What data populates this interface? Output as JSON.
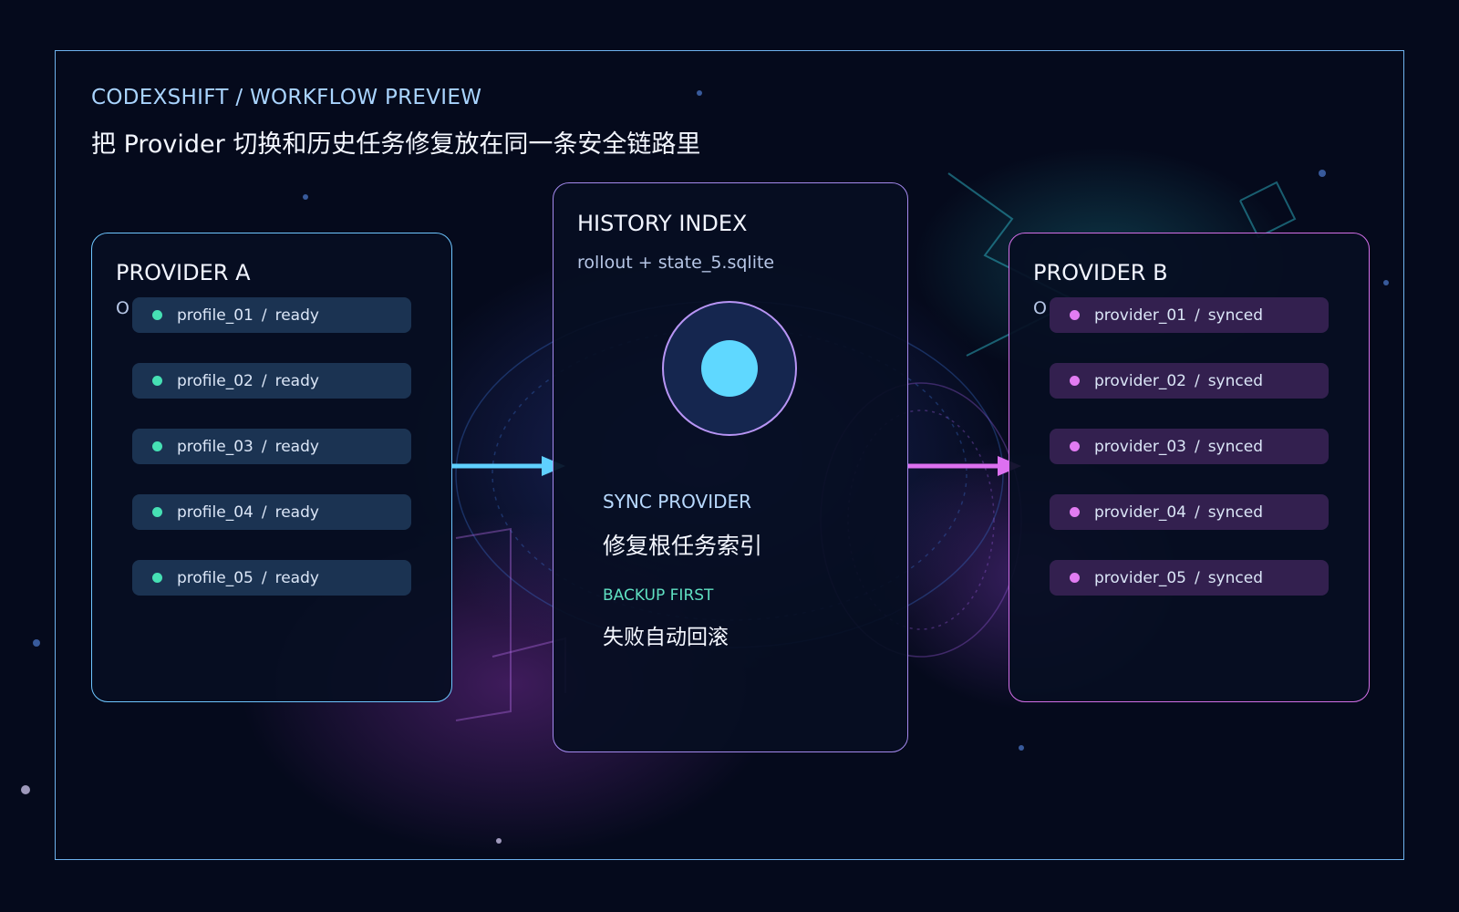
{
  "eyebrow": "CODEXSHIFT / WORKFLOW PREVIEW",
  "headline": "把 Provider 切换和历史任务修复放在同一条安全链路里",
  "colors": {
    "provider_a_accent": "#6ec6ff",
    "provider_a_dot": "#46e0b4",
    "provider_b_accent": "#d36fe8",
    "provider_b_dot": "#e27cf2",
    "history_accent": "#a489ee",
    "orb_core": "#5fd8ff"
  },
  "provider_a": {
    "title": "PROVIDER A",
    "peek": "O",
    "rows": [
      {
        "name": "profile_01",
        "sep": "/",
        "status": "ready"
      },
      {
        "name": "profile_02",
        "sep": "/",
        "status": "ready"
      },
      {
        "name": "profile_03",
        "sep": "/",
        "status": "ready"
      },
      {
        "name": "profile_04",
        "sep": "/",
        "status": "ready"
      },
      {
        "name": "profile_05",
        "sep": "/",
        "status": "ready"
      }
    ]
  },
  "history": {
    "title": "HISTORY INDEX",
    "subtitle": "rollout + state_5.sqlite",
    "sync_label": "SYNC PROVIDER",
    "sync_value": "修复根任务索引",
    "backup_label": "BACKUP FIRST",
    "backup_value": "失败自动回滚"
  },
  "provider_b": {
    "title": "PROVIDER B",
    "peek": "O",
    "rows": [
      {
        "name": "provider_01",
        "sep": "/",
        "status": "synced"
      },
      {
        "name": "provider_02",
        "sep": "/",
        "status": "synced"
      },
      {
        "name": "provider_03",
        "sep": "/",
        "status": "synced"
      },
      {
        "name": "provider_04",
        "sep": "/",
        "status": "synced"
      },
      {
        "name": "provider_05",
        "sep": "/",
        "status": "synced"
      }
    ]
  }
}
